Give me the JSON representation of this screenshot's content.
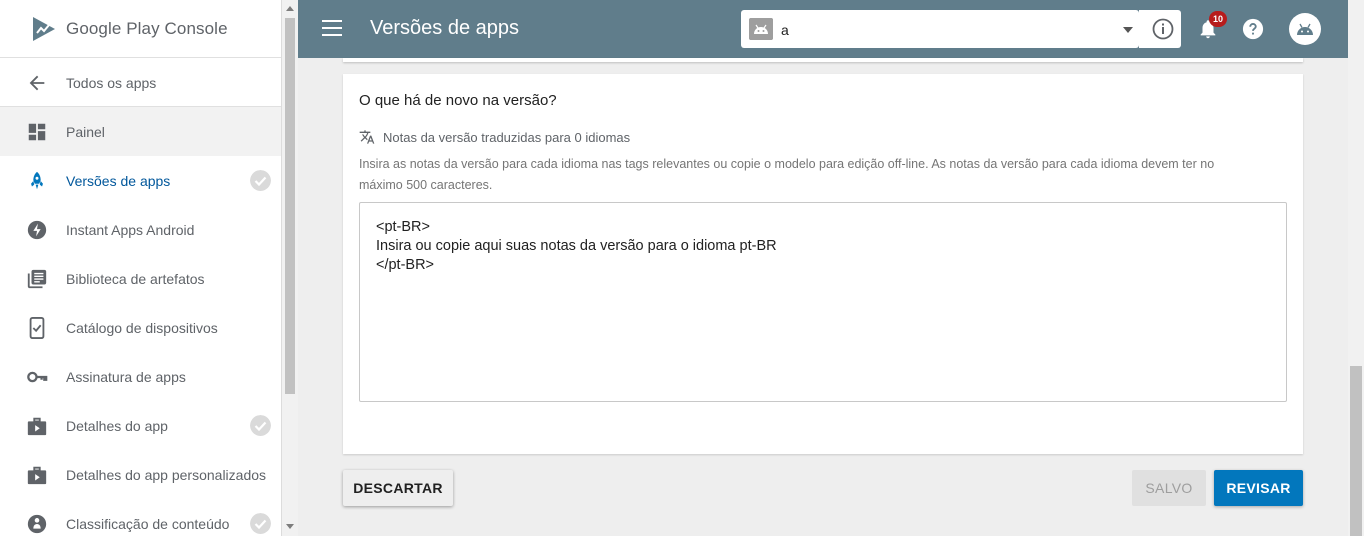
{
  "brand": {
    "name": "Google Play",
    "suffix": "Console"
  },
  "sidebar": {
    "back_label": "Todos os apps",
    "items": [
      {
        "label": "Painel",
        "icon": "dashboard-icon",
        "state": "shaded",
        "checked": false
      },
      {
        "label": "Versões de apps",
        "icon": "rocket-icon",
        "state": "active",
        "checked": true
      },
      {
        "label": "Instant Apps Android",
        "icon": "bolt-icon",
        "state": "",
        "checked": false
      },
      {
        "label": "Biblioteca de artefatos",
        "icon": "library-icon",
        "state": "",
        "checked": false
      },
      {
        "label": "Catálogo de dispositivos",
        "icon": "device-check-icon",
        "state": "",
        "checked": false
      },
      {
        "label": "Assinatura de apps",
        "icon": "key-icon",
        "state": "",
        "checked": false
      },
      {
        "label": "Detalhes do app",
        "icon": "store-icon",
        "state": "",
        "checked": true
      },
      {
        "label": "Detalhes do app personalizados",
        "icon": "store-icon",
        "state": "",
        "checked": false
      },
      {
        "label": "Classificação de conteúdo",
        "icon": "rating-icon",
        "state": "",
        "checked": true
      }
    ]
  },
  "topbar": {
    "title": "Versões de apps",
    "app_selector_value": "a",
    "notification_count": "10"
  },
  "card": {
    "title": "O que há de novo na versão?",
    "translated_note": "Notas da versão traduzidas para 0 idiomas",
    "description": "Insira as notas da versão para cada idioma nas tags relevantes ou copie o modelo para edição off-line. As notas da versão para cada idioma devem ter no máximo 500 caracteres.",
    "notes_value": "<pt-BR>\nInsira ou copie aqui suas notas da versão para o idioma pt-BR\n</pt-BR>"
  },
  "actions": {
    "discard_label": "DESCARTAR",
    "saved_label": "SALVO",
    "review_label": "REVISAR"
  },
  "colors": {
    "topbar": "#607d8b",
    "active_nav": "#01579b",
    "primary_button": "#0277bd",
    "badge": "#b71c1c"
  }
}
